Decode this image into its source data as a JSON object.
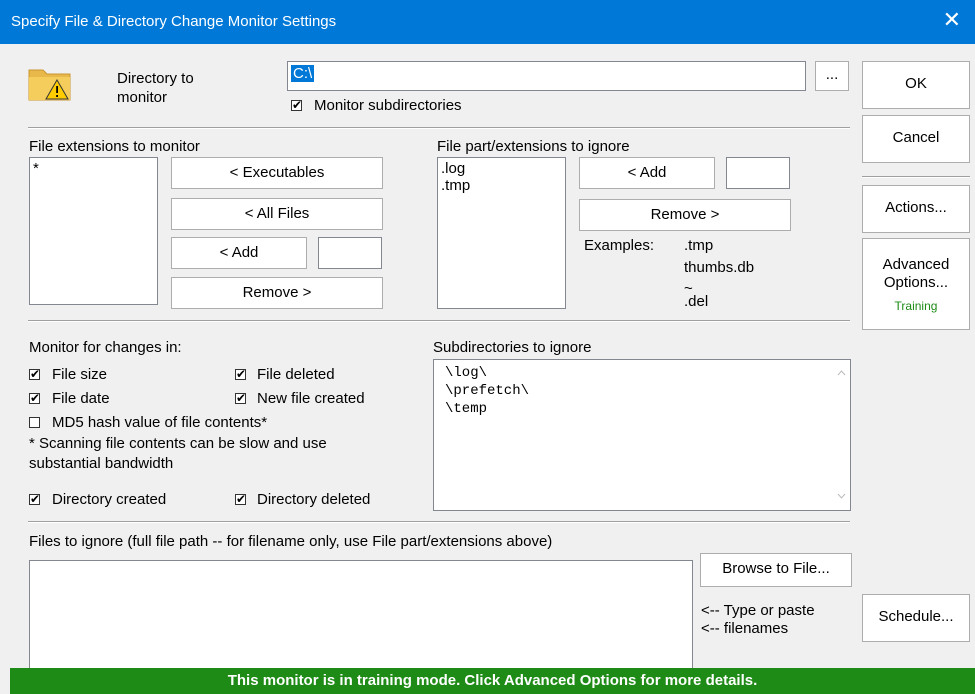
{
  "window": {
    "title": "Specify File & Directory Change Monitor Settings",
    "close_glyph": "✕"
  },
  "directory": {
    "label_line1": "Directory to",
    "label_line2": "monitor",
    "value": "C:\\",
    "browse_label": "...",
    "monitor_subdirs_label": "Monitor subdirectories",
    "monitor_subdirs_checked": true
  },
  "right_buttons": {
    "ok": "OK",
    "cancel": "Cancel",
    "actions": "Actions...",
    "advanced_line1": "Advanced",
    "advanced_line2": "Options...",
    "advanced_sub": "Training",
    "schedule": "Schedule..."
  },
  "extensions": {
    "heading": "File extensions to monitor",
    "items": [
      "*"
    ],
    "executables_label": "< Executables",
    "all_files_label": "< All Files",
    "add_label": "< Add",
    "remove_label": "Remove >",
    "add_value": ""
  },
  "ignore_ext": {
    "heading": "File part/extensions to ignore",
    "items": [
      ".log",
      ".tmp"
    ],
    "add_label": "< Add",
    "remove_label": "Remove >",
    "add_value": "",
    "examples_label": "Examples:",
    "examples": [
      ".tmp",
      "thumbs.db",
      "~",
      ".del"
    ]
  },
  "monitor_changes": {
    "heading": "Monitor for changes in:",
    "file_size": "File size",
    "file_deleted": "File deleted",
    "file_date": "File date",
    "new_file_created": "New file created",
    "md5": "MD5 hash value of file contents*",
    "note_line1": "* Scanning file contents can be slow and use",
    "note_line2": "substantial bandwidth",
    "dir_created": "Directory created",
    "dir_deleted": "Directory deleted",
    "checked": {
      "file_size": true,
      "file_deleted": true,
      "file_date": true,
      "new_file_created": true,
      "md5": false,
      "dir_created": true,
      "dir_deleted": true
    }
  },
  "subdirs_ignore": {
    "heading": "Subdirectories to ignore",
    "items": [
      "\\log\\",
      "\\prefetch\\",
      "\\temp"
    ]
  },
  "files_ignore": {
    "heading": "Files to ignore (full file path -- for filename only, use File part/extensions above)",
    "browse_label": "Browse to File...",
    "hint_line1": "<-- Type or paste",
    "hint_line2": "<-- filenames"
  },
  "status": {
    "text": "This monitor is in training mode.  Click Advanced Options for more details."
  },
  "colors": {
    "accent": "#0078d7",
    "status_green": "#1e8b16",
    "training_green": "#1e8b16"
  }
}
